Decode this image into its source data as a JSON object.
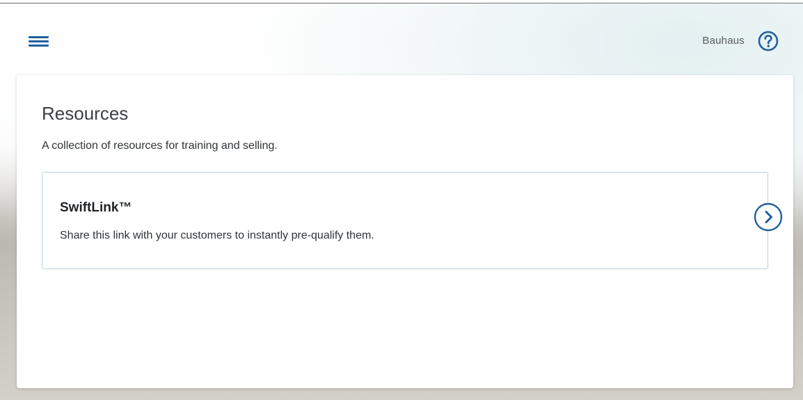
{
  "header": {
    "account_name": "Bauhaus",
    "menu_icon": "hamburger-menu-icon",
    "help_icon": "help-circle-icon"
  },
  "card": {
    "title": "Resources",
    "subtitle": "A collection of resources for training and selling.",
    "resources": [
      {
        "title": "SwiftLink™",
        "description": "Share this link with your customers to instantly pre-qualify them.",
        "action_icon": "chevron-right-circle-icon"
      }
    ]
  },
  "colors": {
    "accent": "#1f5f9e",
    "tile_border": "#bcd0e0"
  }
}
